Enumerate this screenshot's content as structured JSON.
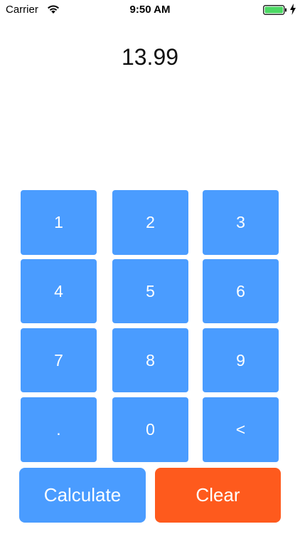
{
  "status_bar": {
    "carrier": "Carrier",
    "time": "9:50 AM",
    "battery_color": "#4cd964"
  },
  "display": {
    "value": "13.99"
  },
  "keypad": {
    "keys": [
      "1",
      "2",
      "3",
      "4",
      "5",
      "6",
      "7",
      "8",
      "9",
      ".",
      "0",
      "<"
    ],
    "key_color": "#4a9cff"
  },
  "actions": {
    "calculate_label": "Calculate",
    "clear_label": "Clear",
    "calculate_color": "#4a9cff",
    "clear_color": "#fe5a1d"
  }
}
